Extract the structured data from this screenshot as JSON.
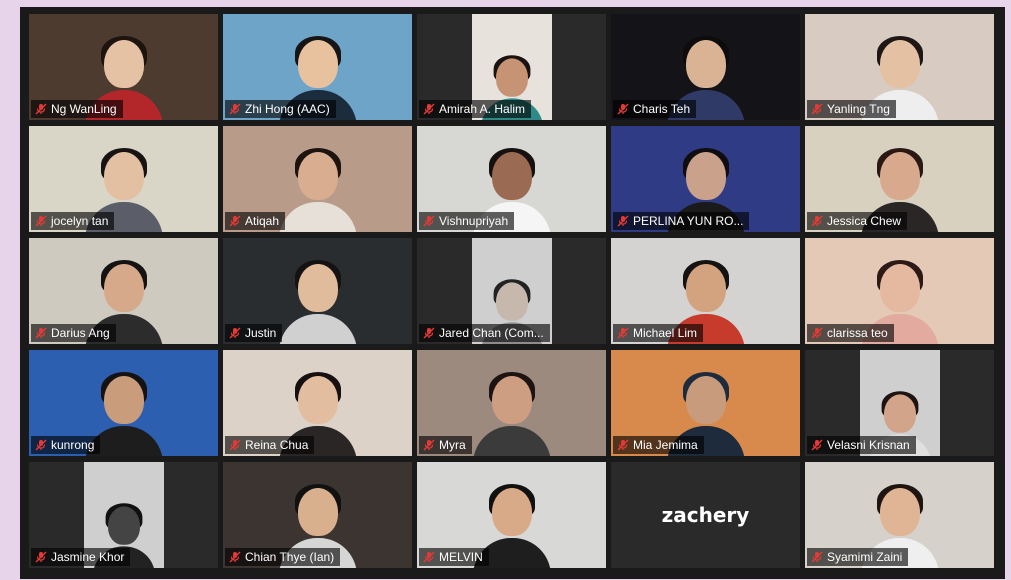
{
  "meeting": {
    "participants": [
      {
        "name": "Ng WanLing",
        "bg": "#4d3b30",
        "skin": "#e6c2a4",
        "hair": "#1e140f",
        "shirt": "#b3262a",
        "video": true
      },
      {
        "name": "Zhi Hong (AAC)",
        "bg": "#6fa4c9",
        "skin": "#e8c19f",
        "hair": "#151515",
        "shirt": "#1b2c3d",
        "video": true
      },
      {
        "name": "Amirah A. Halim",
        "bg": "#e7e2dc",
        "skin": "#c69474",
        "hair": "#1a1210",
        "shirt": "#2d8a86",
        "video": true,
        "inset": true
      },
      {
        "name": "Charis Teh",
        "bg": "#141418",
        "skin": "#d9b394",
        "hair": "#0d0b0b",
        "shirt": "#2f3b66",
        "video": true
      },
      {
        "name": "Yanling Tng",
        "bg": "#d8cbc2",
        "skin": "#e5c1a3",
        "hair": "#1e1715",
        "shirt": "#eeeeee",
        "video": true
      },
      {
        "name": "jocelyn tan",
        "bg": "#d9d6c8",
        "skin": "#e3c0a2",
        "hair": "#171313",
        "shirt": "#5b5e68",
        "video": true
      },
      {
        "name": "Atiqah",
        "bg": "#b99b8a",
        "skin": "#d9ad8f",
        "hair": "#1d1410",
        "shirt": "#e6e0d8",
        "video": true
      },
      {
        "name": "Vishnupriyah",
        "bg": "#d7d7d3",
        "skin": "#9a6b52",
        "hair": "#161010",
        "shirt": "#f5f5f5",
        "video": true
      },
      {
        "name": "PERLINA YUN RO...",
        "bg": "#2f3b84",
        "skin": "#caa28c",
        "hair": "#0f0d10",
        "shirt": "#1a1a1a",
        "video": true
      },
      {
        "name": "Jessica Chew",
        "bg": "#d8d1c0",
        "skin": "#d8a98d",
        "hair": "#2a1814",
        "shirt": "#2a2626",
        "video": true
      },
      {
        "name": "Darius Ang",
        "bg": "#cfcabf",
        "skin": "#d6a98a",
        "hair": "#141212",
        "shirt": "#2c2c2c",
        "video": true
      },
      {
        "name": "Justin",
        "bg": "#2a2d30",
        "skin": "#e1bc9c",
        "hair": "#141212",
        "shirt": "#d0d0d0",
        "video": true
      },
      {
        "name": "Jared Chan (Com...",
        "bg": "#2a2a2a",
        "skin": "#c6b8ad",
        "hair": "#222",
        "shirt": "#8d8d8d",
        "video": true,
        "inset": true
      },
      {
        "name": "Michael Lim",
        "bg": "#d4d3d2",
        "skin": "#d3a27e",
        "hair": "#141212",
        "shirt": "#c73b2d",
        "video": true
      },
      {
        "name": "clarissa teo",
        "bg": "#e4c9b6",
        "skin": "#e5b9a0",
        "hair": "#2d1a16",
        "shirt": "#e3aaa0",
        "video": true
      },
      {
        "name": "kunrong",
        "bg": "#2c5fb0",
        "skin": "#c99c7c",
        "hair": "#141212",
        "shirt": "#1d1d1d",
        "video": true
      },
      {
        "name": "Reina Chua",
        "bg": "#ddd2c7",
        "skin": "#e3bd9f",
        "hair": "#171010",
        "shirt": "#2a2626",
        "video": true
      },
      {
        "name": "Myra",
        "bg": "#9c8a7f",
        "skin": "#cd9e82",
        "hair": "#1d1310",
        "shirt": "#3b3b3b",
        "video": true
      },
      {
        "name": "Mia Jemima",
        "bg": "#d88a4c",
        "skin": "#c89b7c",
        "hair": "#1d2b3d",
        "shirt": "#1d2b3d",
        "video": true
      },
      {
        "name": "Velasni Krisnan",
        "bg": "#2a2a2a",
        "skin": "#d2a58a",
        "hair": "#1d1310",
        "shirt": "#e0e0e0",
        "video": true,
        "inset": true
      },
      {
        "name": "Jasmine Khor",
        "bg": "#2a2a2a",
        "skin": "#444",
        "hair": "#111",
        "shirt": "#222",
        "video": true,
        "inset": true
      },
      {
        "name": "Chian Thye (Ian)",
        "bg": "#3b3430",
        "skin": "#d9b08e",
        "hair": "#111",
        "shirt": "#d6d6d6",
        "video": true,
        "active": true
      },
      {
        "name": "MELVIN",
        "bg": "#d8d8d6",
        "skin": "#d8aa88",
        "hair": "#111",
        "shirt": "#1e1e1e",
        "video": true
      },
      {
        "name": "zachery",
        "video": false
      },
      {
        "name": "Syamimi Zaini",
        "bg": "#d6d1cb",
        "skin": "#e0b596",
        "hair": "#1e1510",
        "shirt": "#efefef",
        "video": true
      }
    ],
    "mic_icon": "muted-mic-icon",
    "accent_active": "#c9e07a",
    "muted_color": "#e53935"
  }
}
